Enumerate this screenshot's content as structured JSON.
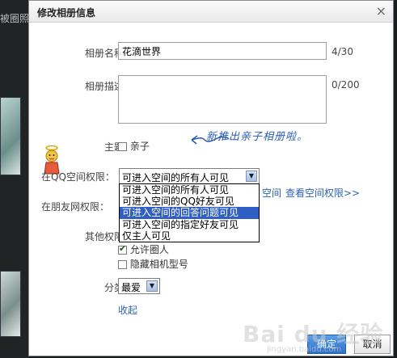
{
  "background": {
    "partial_text": "被圈照"
  },
  "dialog": {
    "title": "修改相册信息",
    "close_symbol": "×",
    "album_name": {
      "label": "相册名称：",
      "value": "花滴世界",
      "counter": "4/30"
    },
    "album_desc": {
      "label": "相册描述：",
      "value": "",
      "counter": "0/200"
    },
    "theme": {
      "label": "主题：",
      "option_label": "亲子",
      "checked": false
    },
    "annotation_text": "新推出亲子相册啦。",
    "qq_space_permission": {
      "label": "在QQ空间权限：",
      "selected": "可进入空间的所有人可见",
      "options": [
        "可进入空间的所有人可见",
        "可进入空间的QQ好友可见",
        "可进入空间的回答问题可见",
        "可进入空间的指定好友可见",
        "仅主人可见"
      ],
      "highlighted_index": 2,
      "link_partial": "空间",
      "link_view": "查看空间权限>>"
    },
    "friend_net_permission": {
      "label": "在朋友网权限："
    },
    "other_permission": {
      "label": "其他权限：",
      "allow_circle": {
        "label": "允许圈人",
        "checked": true
      },
      "hide_camera": {
        "label": "隐藏相机型号",
        "checked": false
      }
    },
    "category": {
      "label": "分类：",
      "selected": "最爱"
    },
    "collapse_link": "收起",
    "ok_button": "确定",
    "cancel_button": "取消"
  },
  "watermark": {
    "text": "Bai du 经验",
    "sub": "jingyan.baidu.com"
  },
  "colors": {
    "accent": "#2b63b4",
    "highlight": "#2f5fc4",
    "ok_button": "#2e70c8"
  }
}
